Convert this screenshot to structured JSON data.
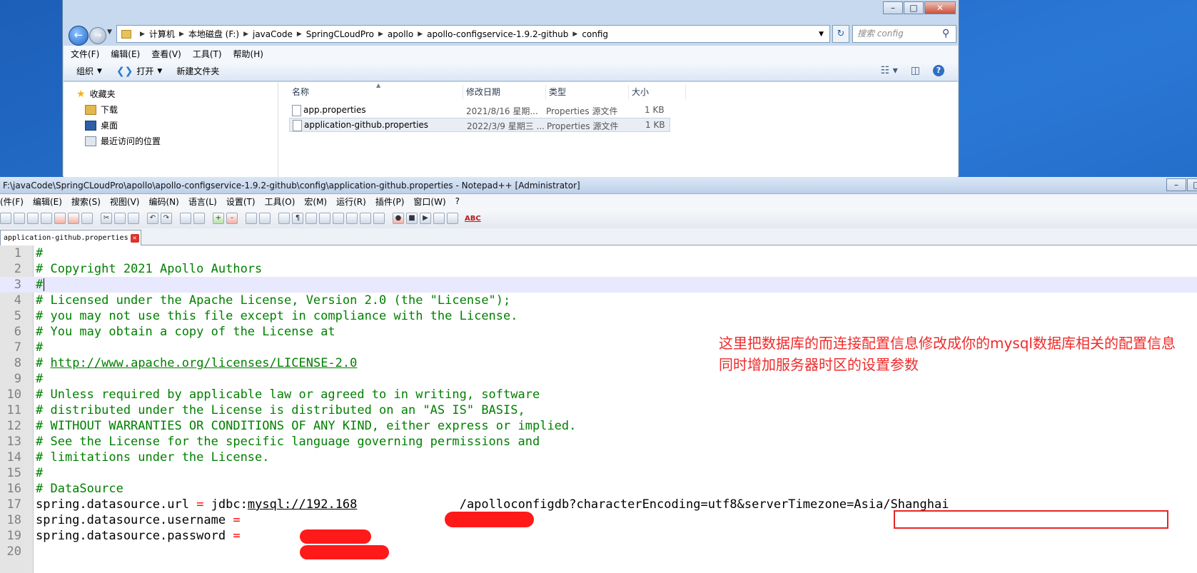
{
  "explorer": {
    "address": {
      "crumbs": [
        "计算机",
        "本地磁盘 (F:)",
        "javaCode",
        "SpringCLoudPro",
        "apollo",
        "apollo-configservice-1.9.2-github",
        "config"
      ]
    },
    "search_placeholder": "搜索 config",
    "menu": [
      "文件(F)",
      "编辑(E)",
      "查看(V)",
      "工具(T)",
      "帮助(H)"
    ],
    "toolbar": {
      "organize": "组织",
      "open": "打开",
      "new_folder": "新建文件夹"
    },
    "nav": [
      {
        "label": "收藏夹",
        "icon": "star-icon"
      },
      {
        "label": "下载",
        "icon": "downloads-folder-icon"
      },
      {
        "label": "桌面",
        "icon": "desktop-icon"
      },
      {
        "label": "最近访问的位置",
        "icon": "recent-places-icon"
      }
    ],
    "columns": [
      "名称",
      "修改日期",
      "类型",
      "大小"
    ],
    "files": [
      {
        "name": "app.properties",
        "date": "2021/8/16 星期...",
        "type": "Properties 源文件",
        "size": "1 KB",
        "selected": false
      },
      {
        "name": "application-github.properties",
        "date": "2022/3/9 星期三 ...",
        "type": "Properties 源文件",
        "size": "1 KB",
        "selected": true
      }
    ]
  },
  "npp": {
    "title": "F:\\javaCode\\SpringCLoudPro\\apollo\\apollo-configservice-1.9.2-github\\config\\application-github.properties - Notepad++ [Administrator]",
    "menu": [
      "(件(F)",
      "编辑(E)",
      "搜索(S)",
      "视图(V)",
      "编码(N)",
      "语言(L)",
      "设置(T)",
      "工具(O)",
      "宏(M)",
      "运行(R)",
      "插件(P)",
      "窗口(W)",
      "?"
    ],
    "tab_label": "application-github.properties",
    "lines": [
      {
        "n": "1",
        "text": "#"
      },
      {
        "n": "2",
        "text": "# Copyright 2021 Apollo Authors"
      },
      {
        "n": "3",
        "text": "#"
      },
      {
        "n": "4",
        "text": "# Licensed under the Apache License, Version 2.0 (the \"License\");"
      },
      {
        "n": "5",
        "text": "# you may not use this file except in compliance with the License."
      },
      {
        "n": "6",
        "text": "# You may obtain a copy of the License at"
      },
      {
        "n": "7",
        "text": "#"
      },
      {
        "n": "8",
        "text": "#",
        "url": "http://www.apache.org/licenses/LICENSE-2.0"
      },
      {
        "n": "9",
        "text": "#"
      },
      {
        "n": "10",
        "text": "# Unless required by applicable law or agreed to in writing, software"
      },
      {
        "n": "11",
        "text": "# distributed under the License is distributed on an \"AS IS\" BASIS,"
      },
      {
        "n": "12",
        "text": "# WITHOUT WARRANTIES OR CONDITIONS OF ANY KIND, either express or implied."
      },
      {
        "n": "13",
        "text": "# See the License for the specific language governing permissions and"
      },
      {
        "n": "14",
        "text": "# limitations under the License."
      },
      {
        "n": "15",
        "text": "#"
      },
      {
        "n": "16",
        "text": "# DataSource"
      },
      {
        "n": "17",
        "key": "spring.datasource.url",
        "value_prefix": "jdbc:",
        "value_link": "mysql://192.168",
        "value_gap": "              ",
        "value_rest": "/apolloconfigdb?characterEncoding=utf8",
        "value_highlight": "&serverTimezone=Asia/Shanghai"
      },
      {
        "n": "18",
        "key": "spring.datasource.username",
        "value": ""
      },
      {
        "n": "19",
        "key": "spring.datasource.password",
        "value": ""
      },
      {
        "n": "20",
        "text": ""
      }
    ]
  },
  "annotation": {
    "line1": "这里把数据库的而连接配置信息修改成你的mysql数据库相关的配置信息",
    "line2": "同时增加服务器时区的设置参数"
  },
  "colors": {
    "comment": "#008000",
    "operator": "#ff0000",
    "annotation": "#ee2b2b",
    "current_line": "#e8e8ff"
  }
}
